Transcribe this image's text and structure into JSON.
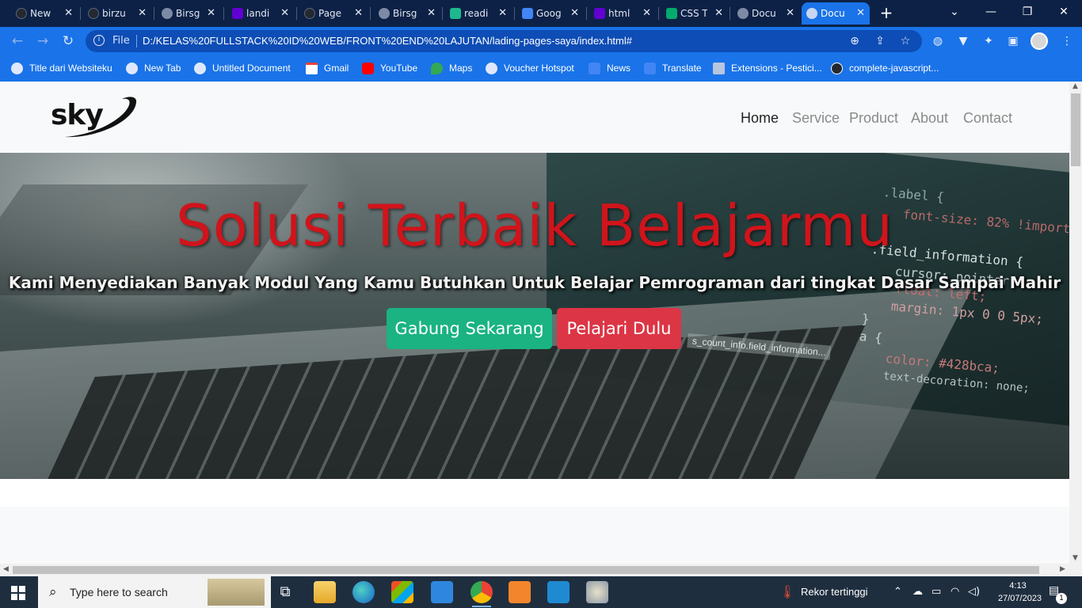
{
  "browser": {
    "tabs": [
      {
        "title": "New",
        "icon": "github-icon",
        "color": "#24292f"
      },
      {
        "title": "birzu",
        "icon": "github-icon",
        "color": "#24292f"
      },
      {
        "title": "Birsg",
        "icon": "globe-icon",
        "color": "#7d8aa5"
      },
      {
        "title": "landi",
        "icon": "yahoo-icon",
        "color": "#6001d2"
      },
      {
        "title": "Page",
        "icon": "github-icon",
        "color": "#24292f"
      },
      {
        "title": "Birsg",
        "icon": "globe-icon",
        "color": "#7d8aa5"
      },
      {
        "title": "readi",
        "icon": "readme-icon",
        "color": "#1fb88e"
      },
      {
        "title": "Goog",
        "icon": "google-translate-icon",
        "color": "#4285f4"
      },
      {
        "title": "html",
        "icon": "yahoo-icon",
        "color": "#6001d2"
      },
      {
        "title": "CSS T",
        "icon": "w3schools-icon",
        "color": "#04aa6d"
      },
      {
        "title": "Docu",
        "icon": "globe-icon",
        "color": "#7d8aa5"
      },
      {
        "title": "Docu",
        "icon": "globe-icon",
        "color": "#7d8aa5",
        "active": true
      }
    ],
    "close_glyph": "✕",
    "new_tab_glyph": "+",
    "file_label": "File",
    "url": "D:/KELAS%20FULLSTACK%20ID%20WEB/FRONT%20END%20LAJUTAN/lading-pages-saya/index.html#",
    "bookmarks": [
      {
        "label": "Title dari Websiteku",
        "icon": "globe-icon"
      },
      {
        "label": "New Tab",
        "icon": "globe-icon"
      },
      {
        "label": "Untitled Document",
        "icon": "globe-icon"
      },
      {
        "label": "Gmail",
        "icon": "gmail-icon"
      },
      {
        "label": "YouTube",
        "icon": "youtube-icon"
      },
      {
        "label": "Maps",
        "icon": "maps-icon"
      },
      {
        "label": "Voucher Hotspot",
        "icon": "globe-icon"
      },
      {
        "label": "News",
        "icon": "news-icon"
      },
      {
        "label": "Translate",
        "icon": "google-translate-icon"
      },
      {
        "label": "Extensions - Pestici...",
        "icon": "puzzle-icon"
      },
      {
        "label": "complete-javascript...",
        "icon": "github-icon"
      }
    ]
  },
  "page": {
    "logo_text": "sky",
    "nav": [
      {
        "label": "Home",
        "active": true
      },
      {
        "label": "Service",
        "active": false
      },
      {
        "label": "Product",
        "active": false
      },
      {
        "label": "About",
        "active": false
      },
      {
        "label": "Contact",
        "active": false
      }
    ],
    "hero": {
      "title": "Solusi Terbaik Belajarmu",
      "subtitle": "Kami Menyediakan Banyak Modul Yang Kamu Butuhkan Untuk Belajar Pemrograman dari tingkat Dasar Sampai Mahir",
      "primary_button": "Gabung Sekarang",
      "secondary_button": "Pelajari Dulu",
      "code_snippets": [
        ".label {",
        "font-size: 82% !import",
        ".field_information {",
        "cursor: pointer;",
        "float: left;",
        "margin: 1px 0 0 5px;",
        "}",
        "a {",
        "color: #428bca;",
        "text-decoration: none;",
        "s_count_info.field_information..."
      ]
    },
    "colors": {
      "title_red": "#d0141b",
      "join_green": "#1ab381",
      "learn_red": "#dc3545",
      "chrome_blue": "#1a73e8"
    }
  },
  "taskbar": {
    "search_placeholder": "Type here to search",
    "weather_text": "Rekor tertinggi",
    "time": "4:13",
    "date": "27/07/2023",
    "notification_count": "1"
  }
}
